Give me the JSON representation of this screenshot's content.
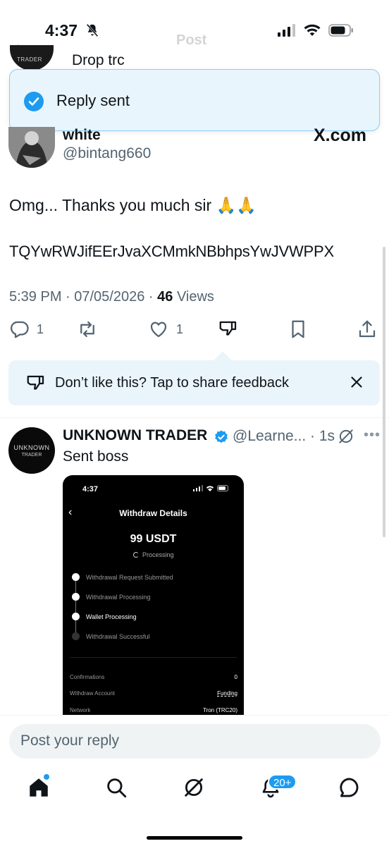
{
  "status_bar": {
    "time": "4:37"
  },
  "header": {
    "title": "Post"
  },
  "prev_tweet": {
    "snippet": "Drop trc",
    "avatar_text": "TRADER"
  },
  "toast": {
    "message": "Reply sent"
  },
  "tweet": {
    "author_name": "white",
    "author_handle": "@bintang660",
    "watermark": "X.com",
    "text": "Omg... Thanks you much sir 🙏🙏",
    "wallet": "TQYwRWJifEErJvaXCMmkNBbhpsYwJVWPPX",
    "time": "5:39 PM · 07/05/2026 · ",
    "views_count": "46",
    "views_label": " Views",
    "replies": "1",
    "likes": "1"
  },
  "feedback": {
    "text": "Don’t like this? Tap to share feedback"
  },
  "reply": {
    "avatar_line1": "UNKNOWN",
    "avatar_line2": "TRADER",
    "name": "UNKNOWN TRADER",
    "handle": "@Learne... · 1s",
    "text": "Sent boss",
    "embed": {
      "time": "4:37",
      "title": "Withdraw Details",
      "amount": "99 USDT",
      "status": "Processing",
      "steps": [
        {
          "label": "Withdrawal Request Submitted",
          "done": true
        },
        {
          "label": "Withdrawal Processing",
          "done": true
        },
        {
          "label": "Wallet Processing",
          "done": true
        },
        {
          "label": "Withdrawal Successful",
          "done": false
        }
      ],
      "rows": [
        {
          "label": "Confirmations",
          "value": "0"
        },
        {
          "label": "Withdraw Account",
          "value": "Funding"
        },
        {
          "label": "Network",
          "value": "Tron (TRC20)"
        }
      ]
    }
  },
  "composer": {
    "placeholder": "Post your reply"
  },
  "tabbar": {
    "notifications_badge": "20+"
  },
  "colors": {
    "accent": "#1d9bf0",
    "text": "#0f1419",
    "muted": "#536471"
  }
}
